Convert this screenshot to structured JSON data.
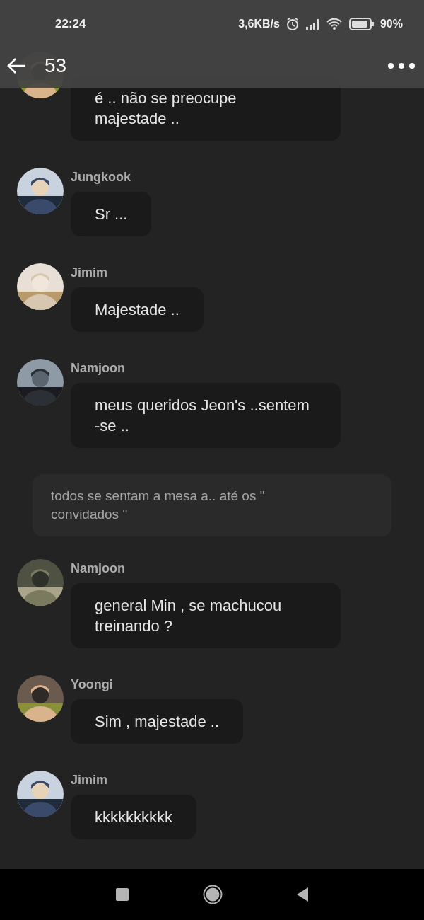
{
  "status_bar": {
    "time": "22:24",
    "speed": "3,6KB/s",
    "battery": "90%"
  },
  "header": {
    "title": "53"
  },
  "messages": [
    {
      "kind": "unnamed",
      "text": "é .. não se preocupe\nmajestade .."
    },
    {
      "kind": "message",
      "sender": "Jungkook",
      "text": "Sr ..."
    },
    {
      "kind": "message",
      "sender": "Jimim",
      "text": "Majestade .."
    },
    {
      "kind": "message",
      "sender": "Namjoon",
      "text": "meus queridos Jeon's ..sentem -se .."
    },
    {
      "kind": "narration",
      "text": "todos se sentam a mesa a.. até os \" convidados \""
    },
    {
      "kind": "message",
      "sender": "Namjoon",
      "text": "general Min , se machucou treinando ?"
    },
    {
      "kind": "message",
      "sender": "Yoongi",
      "text": "Sim , majestade .."
    },
    {
      "kind": "message",
      "sender": "Jimim",
      "text": "kkkkkkkkkk"
    }
  ]
}
